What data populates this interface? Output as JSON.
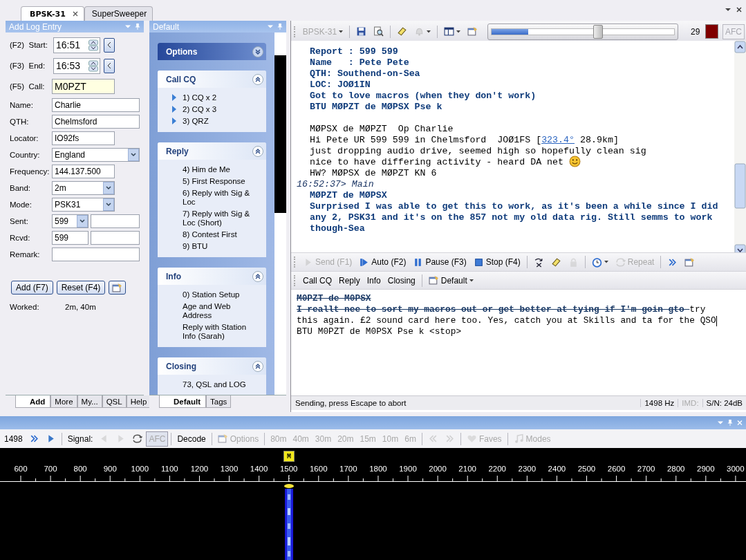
{
  "tabs": [
    {
      "label": "BPSK-31",
      "selected": true,
      "closable": true
    },
    {
      "label": "SuperSweeper",
      "selected": false,
      "closable": false
    }
  ],
  "log_panel": {
    "title": "Add Log Entry",
    "fields": [
      {
        "label": "(F2)  Start:",
        "value": "16:51",
        "kind": "time"
      },
      {
        "label": "(F3)  End:",
        "value": "16:53",
        "kind": "time"
      },
      {
        "label": "(F5)  Call:",
        "value": "M0PZT",
        "kind": "call"
      },
      {
        "label": "Name:",
        "value": "Charlie",
        "kind": "text"
      },
      {
        "label": "QTH:",
        "value": "Chelmsford",
        "kind": "text"
      },
      {
        "label": "Locator:",
        "value": "IO92fs",
        "kind": "short"
      },
      {
        "label": "Country:",
        "value": "England",
        "kind": "combo"
      },
      {
        "label": "Frequency:",
        "value": "144.137.500",
        "kind": "short"
      },
      {
        "label": "Band:",
        "value": "2m",
        "kind": "combo_short"
      },
      {
        "label": "Mode:",
        "value": "PSK31",
        "kind": "combo_short"
      },
      {
        "label": "Sent:",
        "value": "599",
        "kind": "combo_pair"
      },
      {
        "label": "Rcvd:",
        "value": "599",
        "kind": "text_pair"
      },
      {
        "label": "Remark:",
        "kind": "text"
      }
    ],
    "buttons": [
      "Add (F7)",
      "Reset (F4)"
    ],
    "worked_label": "Worked:",
    "worked_value": "2m, 40m",
    "tabs": [
      {
        "label": "Add",
        "selected": true
      },
      {
        "label": "More",
        "selected": false
      },
      {
        "label": "My...",
        "selected": false
      },
      {
        "label": "QSL",
        "selected": false
      },
      {
        "label": "Help",
        "selected": false
      }
    ]
  },
  "macro_panel": {
    "title": "Default",
    "groups": [
      {
        "title": "Options",
        "expanded": false
      },
      {
        "title": "Call CQ",
        "expanded": true,
        "items": [
          {
            "text": "1)  CQ x 2",
            "kind": "play"
          },
          {
            "text": "2)  CQ x 3",
            "kind": "play"
          },
          {
            "text": "3)  QRZ",
            "kind": "play"
          }
        ]
      },
      {
        "title": "Reply",
        "expanded": true,
        "items": [
          {
            "text": "4)  Him de Me",
            "kind": "plain"
          },
          {
            "text": "5)  First Response",
            "kind": "plain"
          },
          {
            "text": "6)  Reply with Sig & Loc",
            "kind": "plain"
          },
          {
            "text": "7)  Reply with Sig & Loc (Short)",
            "kind": "plain"
          },
          {
            "text": "8)  Contest First",
            "kind": "plain"
          },
          {
            "text": "9)  BTU",
            "kind": "plain"
          }
        ]
      },
      {
        "title": "Info",
        "expanded": true,
        "items": [
          {
            "text": "0)  Station Setup",
            "kind": "plain"
          },
          {
            "text": "Age and Web Address",
            "kind": "plain"
          },
          {
            "text": "Reply with Station Info (Sarah)",
            "kind": "plain"
          }
        ]
      },
      {
        "title": "Closing",
        "expanded": true,
        "items": [
          {
            "text": "73, QSL and LOG",
            "kind": "plain"
          }
        ]
      }
    ],
    "tabs": [
      {
        "label": "Default",
        "selected": true
      },
      {
        "label": "Tags",
        "selected": false
      }
    ]
  },
  "receive": {
    "toolbar": [
      {
        "kind": "button",
        "label": "BPSK-31",
        "dropdown": true,
        "disabled": true
      },
      {
        "kind": "separator"
      },
      {
        "kind": "save",
        "disabled": false
      },
      {
        "kind": "preview",
        "disabled": false
      },
      {
        "kind": "separator"
      },
      {
        "kind": "eraser",
        "disabled": false
      },
      {
        "kind": "bell",
        "dropdown": true,
        "disabled": true
      },
      {
        "kind": "separator"
      },
      {
        "kind": "layout",
        "dropdown": true,
        "disabled": false
      },
      {
        "kind": "properties",
        "disabled": false
      }
    ],
    "signal_meter": {
      "level": 0.2
    },
    "slider": {
      "level": 0.58
    },
    "reading": "29",
    "transmitting": true,
    "afc": {
      "label": "AFC",
      "disabled": true
    },
    "lines": [
      {
        "kind": "sent",
        "text": "Report : 599 599"
      },
      {
        "kind": "sent",
        "text": "Name   : Pete Pete"
      },
      {
        "kind": "sent",
        "text": "QTH: Southend-on-Sea"
      },
      {
        "kind": "sent",
        "text": "LOC: JOØ1IN"
      },
      {
        "kind": "sent",
        "text": "Got to love macros (when they don't work)"
      },
      {
        "kind": "sent",
        "text": "BTU MØPZT de MØPSX Pse k"
      },
      {
        "kind": "blank"
      },
      {
        "kind": "received",
        "text": "MØPSX de MØPZT  Op Charlie"
      },
      {
        "kind": "received",
        "text": "Hi Pete UR 599 599 in Chelmsford  JOØ1FS [",
        "link": "323.4°",
        "after": " 28.9km]"
      },
      {
        "kind": "received",
        "text": "just dropping audio drive, seemed high so hopefully clean sig"
      },
      {
        "kind": "received",
        "text": "nice to have differing activity - heard DA net",
        "emoticon": true
      },
      {
        "kind": "received",
        "text": "HW? MØPSX de MØPZT KN 6"
      },
      {
        "kind": "timestamp",
        "text": "16:52:37> Main"
      },
      {
        "kind": "sent",
        "text": "MØPZT de MØPSX"
      },
      {
        "kind": "sent",
        "text": "Surprised I was able to get this to work, as it's been a while since I did"
      },
      {
        "kind": "sent",
        "text": "any 2, PSK31 and it's on the 857 not my old data rig. Still semms to work"
      },
      {
        "kind": "sent",
        "text": "though-Sea"
      }
    ]
  },
  "transmit": {
    "toolbar": [
      {
        "kind": "play",
        "label": "Send (F1)",
        "disabled": true
      },
      {
        "kind": "auto",
        "label": "Auto (F2)",
        "disabled": false
      },
      {
        "kind": "pause",
        "label": "Pause (F3)",
        "disabled": false
      },
      {
        "kind": "stop",
        "label": "Stop (F4)",
        "disabled": false
      },
      {
        "kind": "separator"
      },
      {
        "kind": "cleartx",
        "disabled": false
      },
      {
        "kind": "eraser",
        "disabled": false
      },
      {
        "kind": "lock",
        "disabled": true
      },
      {
        "kind": "separator"
      },
      {
        "kind": "clock",
        "dropdown": true,
        "disabled": false
      },
      {
        "kind": "repeat",
        "label": "Repeat",
        "disabled": true
      },
      {
        "kind": "separator"
      },
      {
        "kind": "chevrons",
        "disabled": false
      },
      {
        "kind": "properties",
        "disabled": false
      }
    ],
    "macro_bar": [
      {
        "kind": "button",
        "label": "Call CQ",
        "disabled": false
      },
      {
        "kind": "button",
        "label": "Reply",
        "disabled": false
      },
      {
        "kind": "button",
        "label": "Info",
        "disabled": false
      },
      {
        "kind": "button",
        "label": "Closing",
        "disabled": false
      },
      {
        "kind": "separator"
      },
      {
        "kind": "properties",
        "label": "Default",
        "dropdown": true,
        "disabled": false
      }
    ],
    "lines": [
      {
        "caret": false,
        "segments": [
          {
            "text": "M0PZT de M0PSX",
            "sent": true
          }
        ]
      },
      {
        "caret": false,
        "segments": [
          {
            "text": "I reallt nee to sort my macros out or get better at tying if I'm goin gto ",
            "sent": true
          },
          {
            "text": "try",
            "sent": false
          }
        ]
      },
      {
        "caret": true,
        "segments": [
          {
            "text": "this again. £2 sound card here too. Yes, catch you at Skills and ta for the QSO",
            "sent": false
          }
        ]
      },
      {
        "caret": false,
        "segments": [
          {
            "text": "BTU M0PZT de M0PSX Pse k <stop>",
            "sent": false
          }
        ]
      }
    ]
  },
  "status_bar": {
    "message": "Sending, press Escape to abort",
    "cells": [
      {
        "text": "1498 Hz",
        "disabled": false
      },
      {
        "text": "IMD:",
        "disabled": true
      },
      {
        "text": "S/N: 24dB",
        "disabled": false
      }
    ]
  },
  "spectrum": {
    "toolbar": [
      {
        "kind": "text",
        "label": "1498"
      },
      {
        "kind": "chevrons",
        "disabled": false
      },
      {
        "kind": "play",
        "disabled": false
      },
      {
        "kind": "separator"
      },
      {
        "kind": "text",
        "label": "Signal:"
      },
      {
        "kind": "left",
        "disabled": true
      },
      {
        "kind": "right",
        "disabled": true
      },
      {
        "kind": "repeat",
        "disabled": false
      },
      {
        "kind": "button",
        "label": "AFC",
        "disabled": true,
        "pressed": true
      },
      {
        "kind": "separator"
      },
      {
        "kind": "button",
        "label": "Decode",
        "disabled": false
      },
      {
        "kind": "separator"
      },
      {
        "kind": "properties",
        "label": "Options",
        "disabled": true
      },
      {
        "kind": "separator"
      },
      {
        "kind": "button",
        "label": "80m",
        "disabled": true
      },
      {
        "kind": "button",
        "label": "40m",
        "disabled": true
      },
      {
        "kind": "button",
        "label": "30m",
        "disabled": true
      },
      {
        "kind": "button",
        "label": "20m",
        "disabled": true
      },
      {
        "kind": "button",
        "label": "15m",
        "disabled": true
      },
      {
        "kind": "button",
        "label": "10m",
        "disabled": true
      },
      {
        "kind": "button",
        "label": "6m",
        "disabled": true
      },
      {
        "kind": "separator"
      },
      {
        "kind": "chevronsleft",
        "disabled": true
      },
      {
        "kind": "chevrons",
        "disabled": true
      },
      {
        "kind": "separator"
      },
      {
        "kind": "heart",
        "label": "Faves",
        "disabled": true
      },
      {
        "kind": "separator"
      },
      {
        "kind": "note",
        "label": "Modes",
        "disabled": true
      }
    ],
    "marker": "M",
    "scale": [
      "600",
      "700",
      "800",
      "900",
      "1000",
      "1100",
      "1200",
      "1300",
      "1400",
      "1500",
      "1600",
      "1700",
      "1800",
      "1900",
      "2000",
      "2100",
      "2200",
      "2300",
      "2400",
      "2500",
      "2600",
      "2700",
      "2800",
      "2900",
      "3000"
    ]
  }
}
